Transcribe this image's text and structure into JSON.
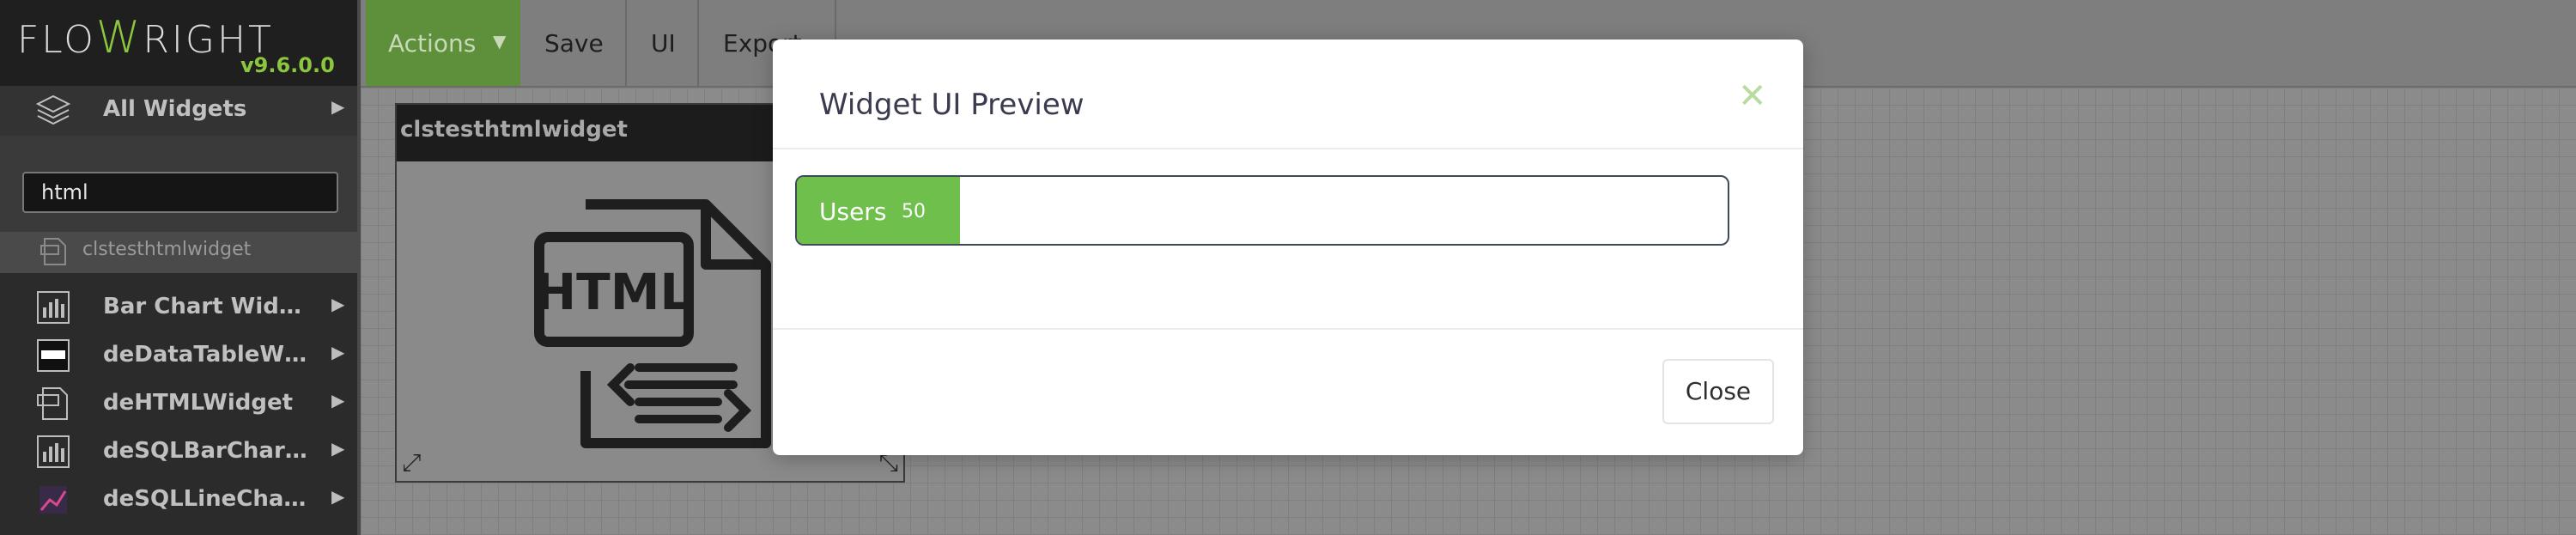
{
  "app": {
    "logo_pre": "FLO",
    "logo_w": "W",
    "logo_post": "RIGHT",
    "version": "v9.6.0.0"
  },
  "sidebar": {
    "all_widgets": "All Widgets",
    "search_value": "html",
    "search_result": "clstesthtmlwidget",
    "items": [
      {
        "label": "Bar Chart Widget",
        "icon": "bar-chart-icon"
      },
      {
        "label": "deDataTableWid…",
        "icon": "html-table-icon"
      },
      {
        "label": "deHTMLWidget",
        "icon": "html-file-icon"
      },
      {
        "label": "deSQLBarChart…",
        "icon": "bar-chart-icon"
      },
      {
        "label": "deSQLLineChart…",
        "icon": "line-chart-icon"
      }
    ]
  },
  "toolbar": {
    "actions": "Actions",
    "save": "Save",
    "ui": "UI",
    "export": "Export"
  },
  "canvas": {
    "widget_title": "clstesthtmlwidget",
    "widget_icon_text": "HTML"
  },
  "modal": {
    "title": "Widget UI Preview",
    "progress_label": "Users",
    "progress_value": "50",
    "progress_percent": 17.5,
    "close_label": "Close"
  },
  "colors": {
    "accent": "#6ebf4b",
    "brand_green": "#8cc63f"
  }
}
